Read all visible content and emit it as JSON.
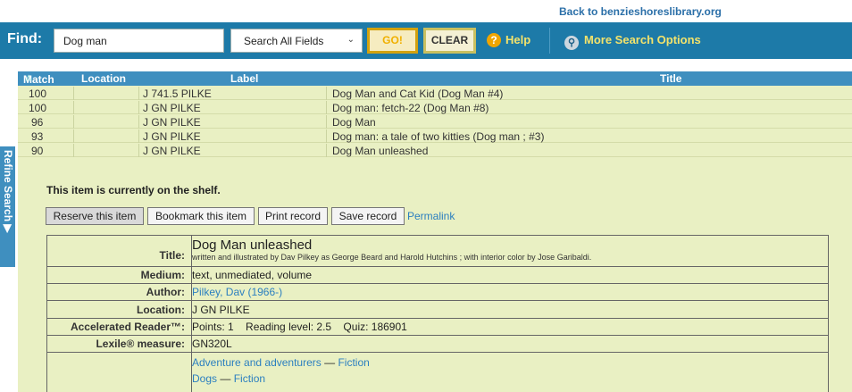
{
  "top_link": "Back to benzieshoreslibrary.org",
  "search": {
    "find_label": "Find:",
    "query": "Dog man",
    "field_select": "Search All Fields",
    "go_label": "GO!",
    "clear_label": "CLEAR",
    "help_label": "Help",
    "more_label": "More Search Options"
  },
  "table": {
    "headers": {
      "match": "Match",
      "location": "Location",
      "label": "Label",
      "title": "Title"
    },
    "rows": [
      {
        "match": "100",
        "location": "",
        "label": "J 741.5 PILKE",
        "title": "Dog Man and Cat Kid (Dog Man #4)"
      },
      {
        "match": "100",
        "location": "",
        "label": "J GN PILKE",
        "title": "Dog man: fetch-22 (Dog Man #8)"
      },
      {
        "match": "96",
        "location": "",
        "label": "J GN PILKE",
        "title": "Dog Man"
      },
      {
        "match": "93",
        "location": "",
        "label": "J GN PILKE",
        "title": "Dog man: a tale of two kitties (Dog man ; #3)"
      },
      {
        "match": "90",
        "location": "",
        "label": "J GN PILKE",
        "title": "Dog Man unleashed"
      }
    ]
  },
  "side_tab": "Refine Search ▶",
  "status_text": "This item is currently on the shelf.",
  "actions": {
    "reserve": "Reserve this item",
    "bookmark": "Bookmark this item",
    "print": "Print record",
    "save": "Save record",
    "permalink": "Permalink"
  },
  "record": {
    "title_label": "Title:",
    "title": "Dog Man unleashed",
    "statement": "written and illustrated by Dav Pilkey as George Beard and Harold Hutchins ; with interior color by Jose Garibaldi.",
    "medium_label": "Medium:",
    "medium": "text, unmediated, volume",
    "author_label": "Author:",
    "author": "Pilkey, Dav (1966-)",
    "location_label": "Location:",
    "location": "J GN PILKE",
    "ar_label": "Accelerated Reader™:",
    "ar_value": "Points: 1    Reading level: 2.5    Quiz: 186901",
    "lexile_label": "Lexile® measure:",
    "lexile": "GN320L",
    "subjects": [
      {
        "topic": "Adventure and adventurers",
        "dash": "—",
        "sub": "Fiction"
      },
      {
        "topic": "Dogs",
        "dash": "—",
        "sub": "Fiction"
      }
    ]
  }
}
